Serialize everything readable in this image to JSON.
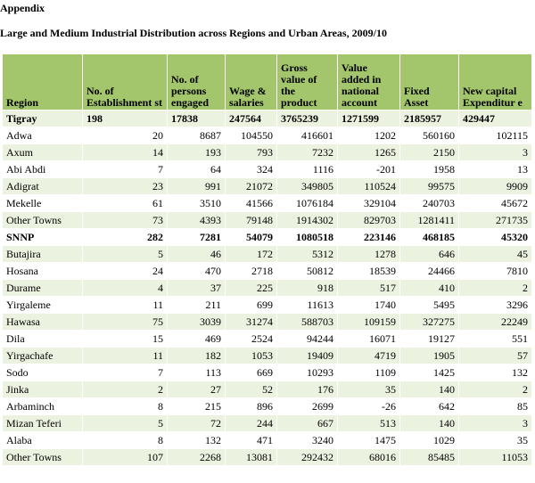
{
  "appendix_title": "Appendix",
  "table_title": "Large and Medium Industrial Distribution across Regions and Urban Areas, 2009/10",
  "columns": [
    "Region",
    "No. of Establishment st",
    "No. of persons engaged",
    "Wage & salaries",
    "Gross value of the product",
    "Value added in national account",
    "Fixed Asset",
    "New capital Expenditur e"
  ],
  "rows": [
    {
      "cells": [
        "Tigray",
        "198",
        "17838",
        "247564",
        "3765239",
        "1271599",
        "2185957",
        "429447"
      ],
      "type": "region-left"
    },
    {
      "cells": [
        "Adwa",
        "20",
        "8687",
        "104550",
        "416601",
        "1202",
        "560160",
        "102115"
      ],
      "type": "town"
    },
    {
      "cells": [
        "Axum",
        "14",
        "193",
        "793",
        "7232",
        "1265",
        "2150",
        "3"
      ],
      "type": "town"
    },
    {
      "cells": [
        "Abi Abdi",
        "7",
        "64",
        "324",
        "1116",
        "-201",
        "1958",
        "13"
      ],
      "type": "town"
    },
    {
      "cells": [
        "Adigrat",
        "23",
        "991",
        "21072",
        "349805",
        "110524",
        "99575",
        "9909"
      ],
      "type": "town"
    },
    {
      "cells": [
        "Mekelle",
        "61",
        "3510",
        "41566",
        "1076184",
        "329104",
        "240703",
        "45672"
      ],
      "type": "town"
    },
    {
      "cells": [
        "Other Towns",
        "73",
        "4393",
        "79148",
        "1914302",
        "829703",
        "1281411",
        "271735"
      ],
      "type": "town"
    },
    {
      "cells": [
        "SNNP",
        "282",
        "7281",
        "54079",
        "1080518",
        "223146",
        "468185",
        "45320"
      ],
      "type": "region-right"
    },
    {
      "cells": [
        "Butajira",
        "5",
        "46",
        "172",
        "5312",
        "1278",
        "646",
        "45"
      ],
      "type": "town"
    },
    {
      "cells": [
        "Hosana",
        "24",
        "470",
        "2718",
        "50812",
        "18539",
        "24466",
        "7810"
      ],
      "type": "town"
    },
    {
      "cells": [
        "Durame",
        "4",
        "37",
        "225",
        "918",
        "517",
        "410",
        "2"
      ],
      "type": "town"
    },
    {
      "cells": [
        "Yirgaleme",
        "11",
        "211",
        "699",
        "11613",
        "1740",
        "5495",
        "3296"
      ],
      "type": "town"
    },
    {
      "cells": [
        "Hawasa",
        "75",
        "3039",
        "31274",
        "588703",
        "109159",
        "327275",
        "22249"
      ],
      "type": "town"
    },
    {
      "cells": [
        "Dila",
        "15",
        "469",
        "2524",
        "94244",
        "16071",
        "19127",
        "551"
      ],
      "type": "town"
    },
    {
      "cells": [
        "Yirgachafe",
        "11",
        "182",
        "1053",
        "19409",
        "4719",
        "1905",
        "57"
      ],
      "type": "town"
    },
    {
      "cells": [
        "Sodo",
        "7",
        "113",
        "669",
        "10293",
        "1109",
        "1425",
        "132"
      ],
      "type": "town"
    },
    {
      "cells": [
        "Jinka",
        "2",
        "27",
        "52",
        "176",
        "35",
        "140",
        "2"
      ],
      "type": "town"
    },
    {
      "cells": [
        "Arbaminch",
        "8",
        "215",
        "896",
        "2699",
        "-26",
        "642",
        "85"
      ],
      "type": "town"
    },
    {
      "cells": [
        "Mizan Teferi",
        "5",
        "72",
        "244",
        "667",
        "513",
        "140",
        "3"
      ],
      "type": "town"
    },
    {
      "cells": [
        "Alaba",
        "8",
        "132",
        "471",
        "3240",
        "1475",
        "1029",
        "35"
      ],
      "type": "town"
    },
    {
      "cells": [
        "Other Towns",
        "107",
        "2268",
        "13081",
        "292432",
        "68016",
        "85485",
        "11053"
      ],
      "type": "town"
    }
  ]
}
